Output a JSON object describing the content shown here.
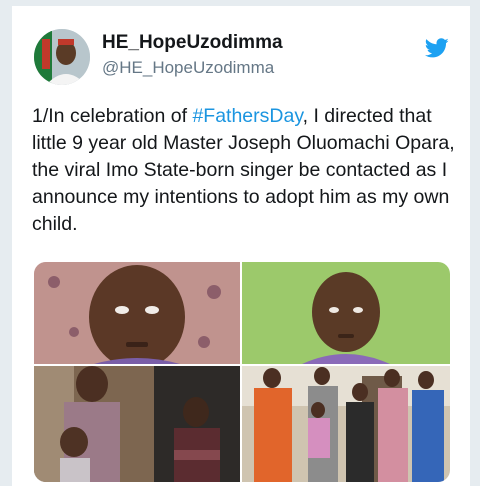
{
  "tweet": {
    "display_name": "HE_HopeUzodimma",
    "handle": "@HE_HopeUzodimma",
    "text_before": "1/In celebration of ",
    "hashtag": "#FathersDay",
    "text_after": ", I directed that little 9 year old Master Joseph Oluomachi Opara, the viral Imo State-born singer be contacted as I announce my intentions to adopt him as my own child."
  },
  "icons": {
    "platform": "twitter-bird-icon"
  },
  "colors": {
    "brand_blue": "#1da1f2",
    "hashtag_blue": "#1b95e0",
    "text": "#14171a",
    "muted": "#657786"
  }
}
